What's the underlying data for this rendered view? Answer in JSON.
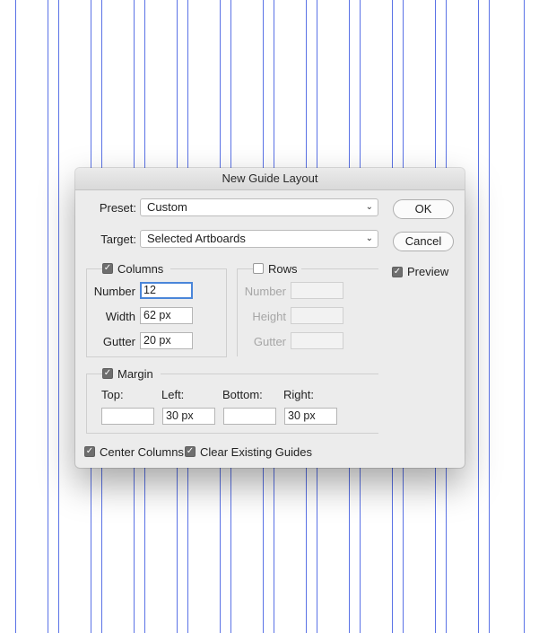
{
  "dialog": {
    "title": "New Guide Layout",
    "preset_label": "Preset:",
    "preset_value": "Custom",
    "target_label": "Target:",
    "target_value": "Selected Artboards",
    "ok_label": "OK",
    "cancel_label": "Cancel",
    "preview_label": "Preview",
    "preview_checked": true
  },
  "columns": {
    "label": "Columns",
    "checked": true,
    "number_label": "Number",
    "number_value": "12",
    "width_label": "Width",
    "width_value": "62 px",
    "gutter_label": "Gutter",
    "gutter_value": "20 px"
  },
  "rows": {
    "label": "Rows",
    "checked": false,
    "number_label": "Number",
    "height_label": "Height",
    "gutter_label": "Gutter"
  },
  "margin": {
    "label": "Margin",
    "checked": true,
    "top_label": "Top:",
    "top_value": "",
    "left_label": "Left:",
    "left_value": "30 px",
    "bottom_label": "Bottom:",
    "bottom_value": "",
    "right_label": "Right:",
    "right_value": "30 px"
  },
  "options": {
    "center_columns_label": "Center Columns",
    "center_columns_checked": true,
    "clear_guides_label": "Clear Existing Guides",
    "clear_guides_checked": true
  },
  "colors": {
    "guide": "#5a72e6",
    "focus": "#4a86d9"
  }
}
